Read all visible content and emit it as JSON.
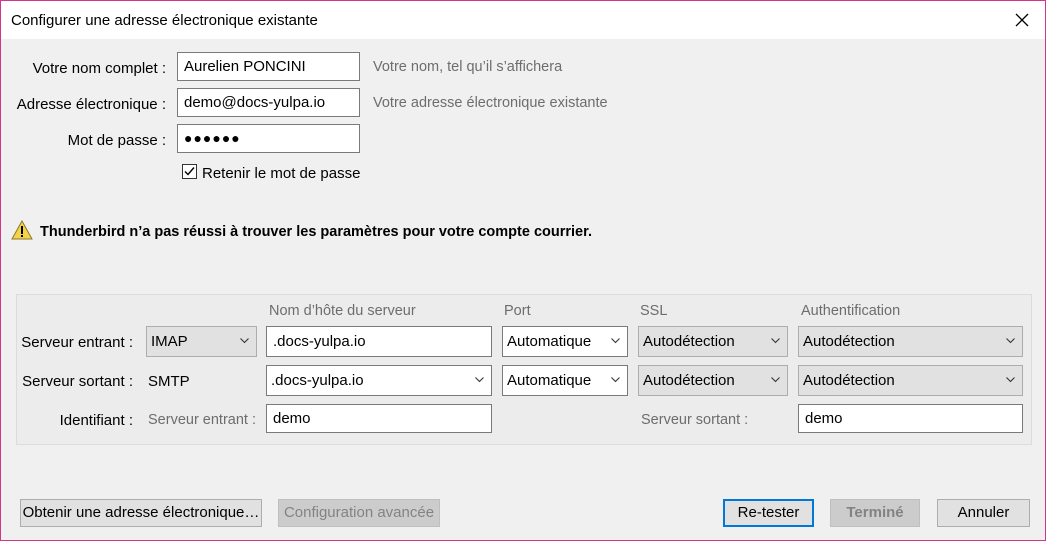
{
  "window": {
    "title": "Configurer une adresse électronique existante",
    "close_icon": "close-icon"
  },
  "identity": {
    "fullname_label": "Votre nom complet :",
    "fullname_value": "Aurelien PONCINI",
    "fullname_hint": "Votre nom, tel qu’il s’affichera",
    "email_label": "Adresse électronique :",
    "email_value": "demo@docs-yulpa.io",
    "email_hint": "Votre adresse électronique existante",
    "password_label": "Mot de passe :",
    "password_value": "●●●●●●",
    "remember_label": "Retenir le mot de passe",
    "remember_checked": true
  },
  "warning": {
    "icon": "warning-icon",
    "text": "Thunderbird n’a pas réussi à trouver les paramètres pour votre compte courrier."
  },
  "servers": {
    "headers": {
      "hostname": "Nom d’hôte du serveur",
      "port": "Port",
      "ssl": "SSL",
      "auth": "Authentification"
    },
    "incoming": {
      "label": "Serveur entrant :",
      "protocol": "IMAP",
      "hostname": ".docs-yulpa.io",
      "port": "Automatique",
      "ssl": "Autodétection",
      "auth": "Autodétection"
    },
    "outgoing": {
      "label": "Serveur sortant :",
      "protocol": "SMTP",
      "hostname": ".docs-yulpa.io",
      "port": "Automatique",
      "ssl": "Autodétection",
      "auth": "Autodétection"
    },
    "username": {
      "label": "Identifiant :",
      "incoming_label": "Serveur entrant :",
      "incoming_value": "demo",
      "outgoing_label": "Serveur sortant :",
      "outgoing_value": "demo"
    }
  },
  "buttons": {
    "get_address": "Obtenir une adresse électronique…",
    "advanced": "Configuration avancée",
    "retest": "Re-tester",
    "done": "Terminé",
    "cancel": "Annuler"
  }
}
